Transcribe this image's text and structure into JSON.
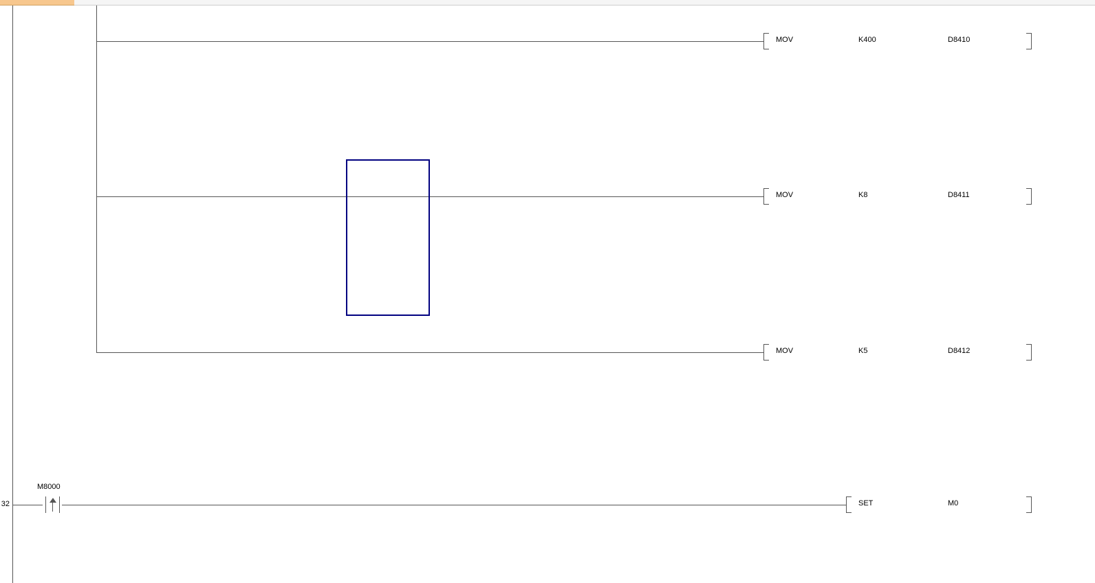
{
  "rungs": [
    {
      "branch": true,
      "instruction": "MOV",
      "operand1": "K400",
      "operand2": "D8410"
    },
    {
      "branch": true,
      "instruction": "MOV",
      "operand1": "K8",
      "operand2": "D8411"
    },
    {
      "branch": true,
      "instruction": "MOV",
      "operand1": "K5",
      "operand2": "D8412"
    },
    {
      "step": "32",
      "contact": "M8000",
      "instruction": "SET",
      "operand1": "M0"
    }
  ]
}
